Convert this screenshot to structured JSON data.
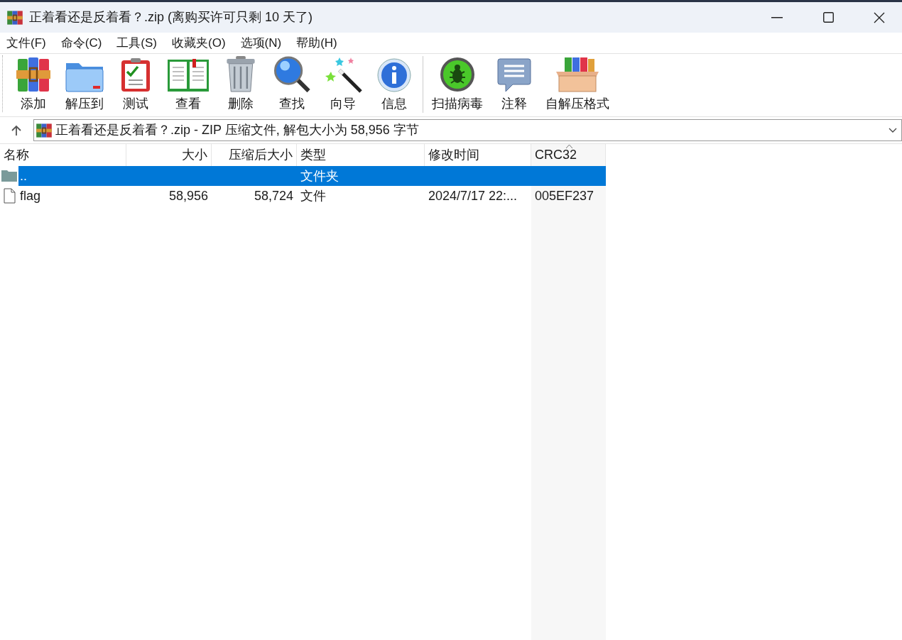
{
  "window": {
    "title": "正着看还是反着看？.zip (离购买许可只剩 10 天了)"
  },
  "menu": [
    "文件(F)",
    "命令(C)",
    "工具(S)",
    "收藏夹(O)",
    "选项(N)",
    "帮助(H)"
  ],
  "toolbar": [
    {
      "kind": "add",
      "label": "添加"
    },
    {
      "kind": "extract",
      "label": "解压到"
    },
    {
      "kind": "test",
      "label": "测试"
    },
    {
      "kind": "view",
      "label": "查看"
    },
    {
      "kind": "delete",
      "label": "删除"
    },
    {
      "kind": "find",
      "label": "查找"
    },
    {
      "kind": "wizard",
      "label": "向导"
    },
    {
      "kind": "info",
      "label": "信息"
    },
    {
      "kind": "virus",
      "label": "扫描病毒"
    },
    {
      "kind": "comment",
      "label": "注释"
    },
    {
      "kind": "sfx",
      "label": "自解压格式"
    }
  ],
  "address": {
    "value": "正着看还是反着看？.zip - ZIP 压缩文件, 解包大小为 58,956 字节"
  },
  "table": {
    "columns": [
      {
        "label": "名称",
        "sorted": false
      },
      {
        "label": "大小",
        "sorted": false
      },
      {
        "label": "压缩后大小",
        "sorted": false
      },
      {
        "label": "类型",
        "sorted": false
      },
      {
        "label": "修改时间",
        "sorted": false
      },
      {
        "label": "CRC32",
        "sorted": true
      }
    ],
    "rows": [
      {
        "kind": "folder",
        "selected": true,
        "cells": [
          "..",
          "",
          "",
          "文件夹",
          "",
          ""
        ]
      },
      {
        "kind": "file",
        "selected": false,
        "cells": [
          "flag",
          "58,956",
          "58,724",
          "文件",
          "2024/7/17 22:...",
          "005EF237"
        ]
      }
    ]
  }
}
